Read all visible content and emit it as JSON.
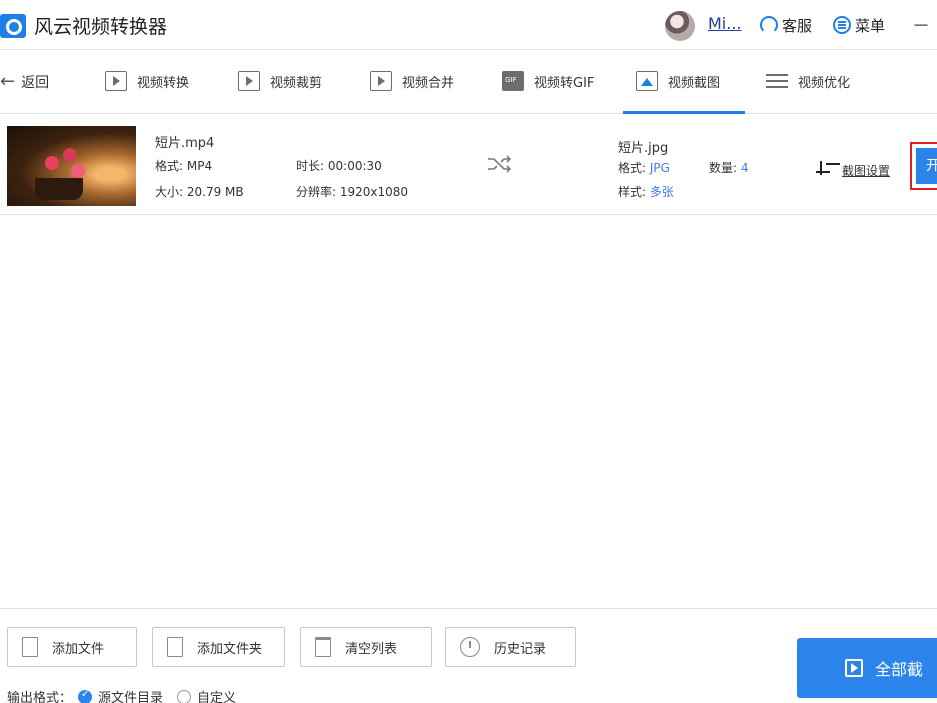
{
  "app": {
    "title": "风云视频转换器",
    "username": "Mi...",
    "service_label": "客服",
    "menu_label": "菜单",
    "minimize_label": "－"
  },
  "nav": {
    "back_label": "返回",
    "tabs": [
      {
        "label": "视频转换",
        "icon": "video-convert-icon"
      },
      {
        "label": "视频裁剪",
        "icon": "video-crop-icon"
      },
      {
        "label": "视频合并",
        "icon": "video-merge-icon"
      },
      {
        "label": "视频转GIF",
        "icon": "gif-icon"
      },
      {
        "label": "视频截图",
        "icon": "screenshot-icon",
        "active": true
      },
      {
        "label": "视频优化",
        "icon": "optimize-icon"
      }
    ]
  },
  "file": {
    "source_name": "短片.mp4",
    "format_key": "格式:",
    "format_value": "MP4",
    "size_key": "大小:",
    "size_value": "20.79 MB",
    "duration_key": "时长:",
    "duration_value": "00:00:30",
    "resolution_key": "分辨率:",
    "resolution_value": "1920x1080",
    "output_name": "短片.jpg",
    "out_format_key": "格式:",
    "out_format_value": "JPG",
    "count_key": "数量:",
    "count_value": "4",
    "style_key": "样式:",
    "style_value": "多张",
    "crop_settings_label": "截图设置",
    "start_label": "开"
  },
  "footer": {
    "add_file": "添加文件",
    "add_folder": "添加文件夹",
    "clear_list": "清空列表",
    "history": "历史记录",
    "output_format_label": "输出格式：",
    "option_source": "源文件目录",
    "option_custom": "自定义",
    "all_button_label": "全部截"
  },
  "colors": {
    "accent": "#2b84ea",
    "highlight_border": "#e02020"
  }
}
